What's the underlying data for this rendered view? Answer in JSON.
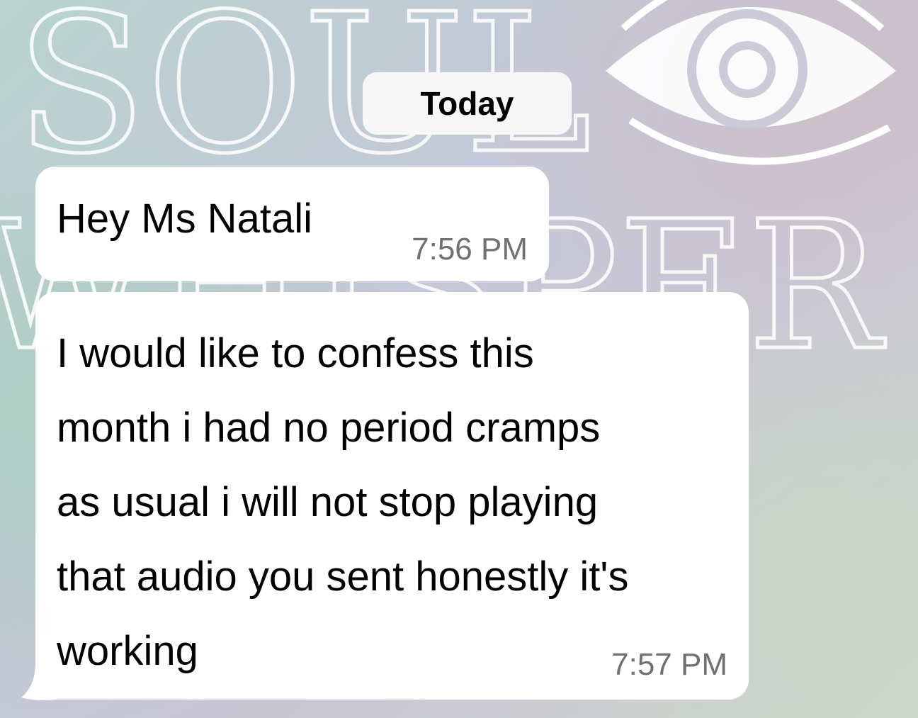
{
  "wallpaper": {
    "watermark_line1": "SOUL",
    "watermark_line2": "WHISPER",
    "watermark_icon": "eye-icon"
  },
  "chat": {
    "date_separator": "Today",
    "messages": [
      {
        "text": "Hey Ms Natali",
        "time": "7:56 PM"
      },
      {
        "text": "I would like to confess this\nmonth i had no period cramps\nas usual i will not stop playing\nthat audio you sent honestly it's\nworking",
        "time": "7:57 PM"
      }
    ]
  },
  "colors": {
    "bubble": "#ffffff",
    "timestamp": "#707074",
    "date_chip": "#f7f7f8"
  }
}
